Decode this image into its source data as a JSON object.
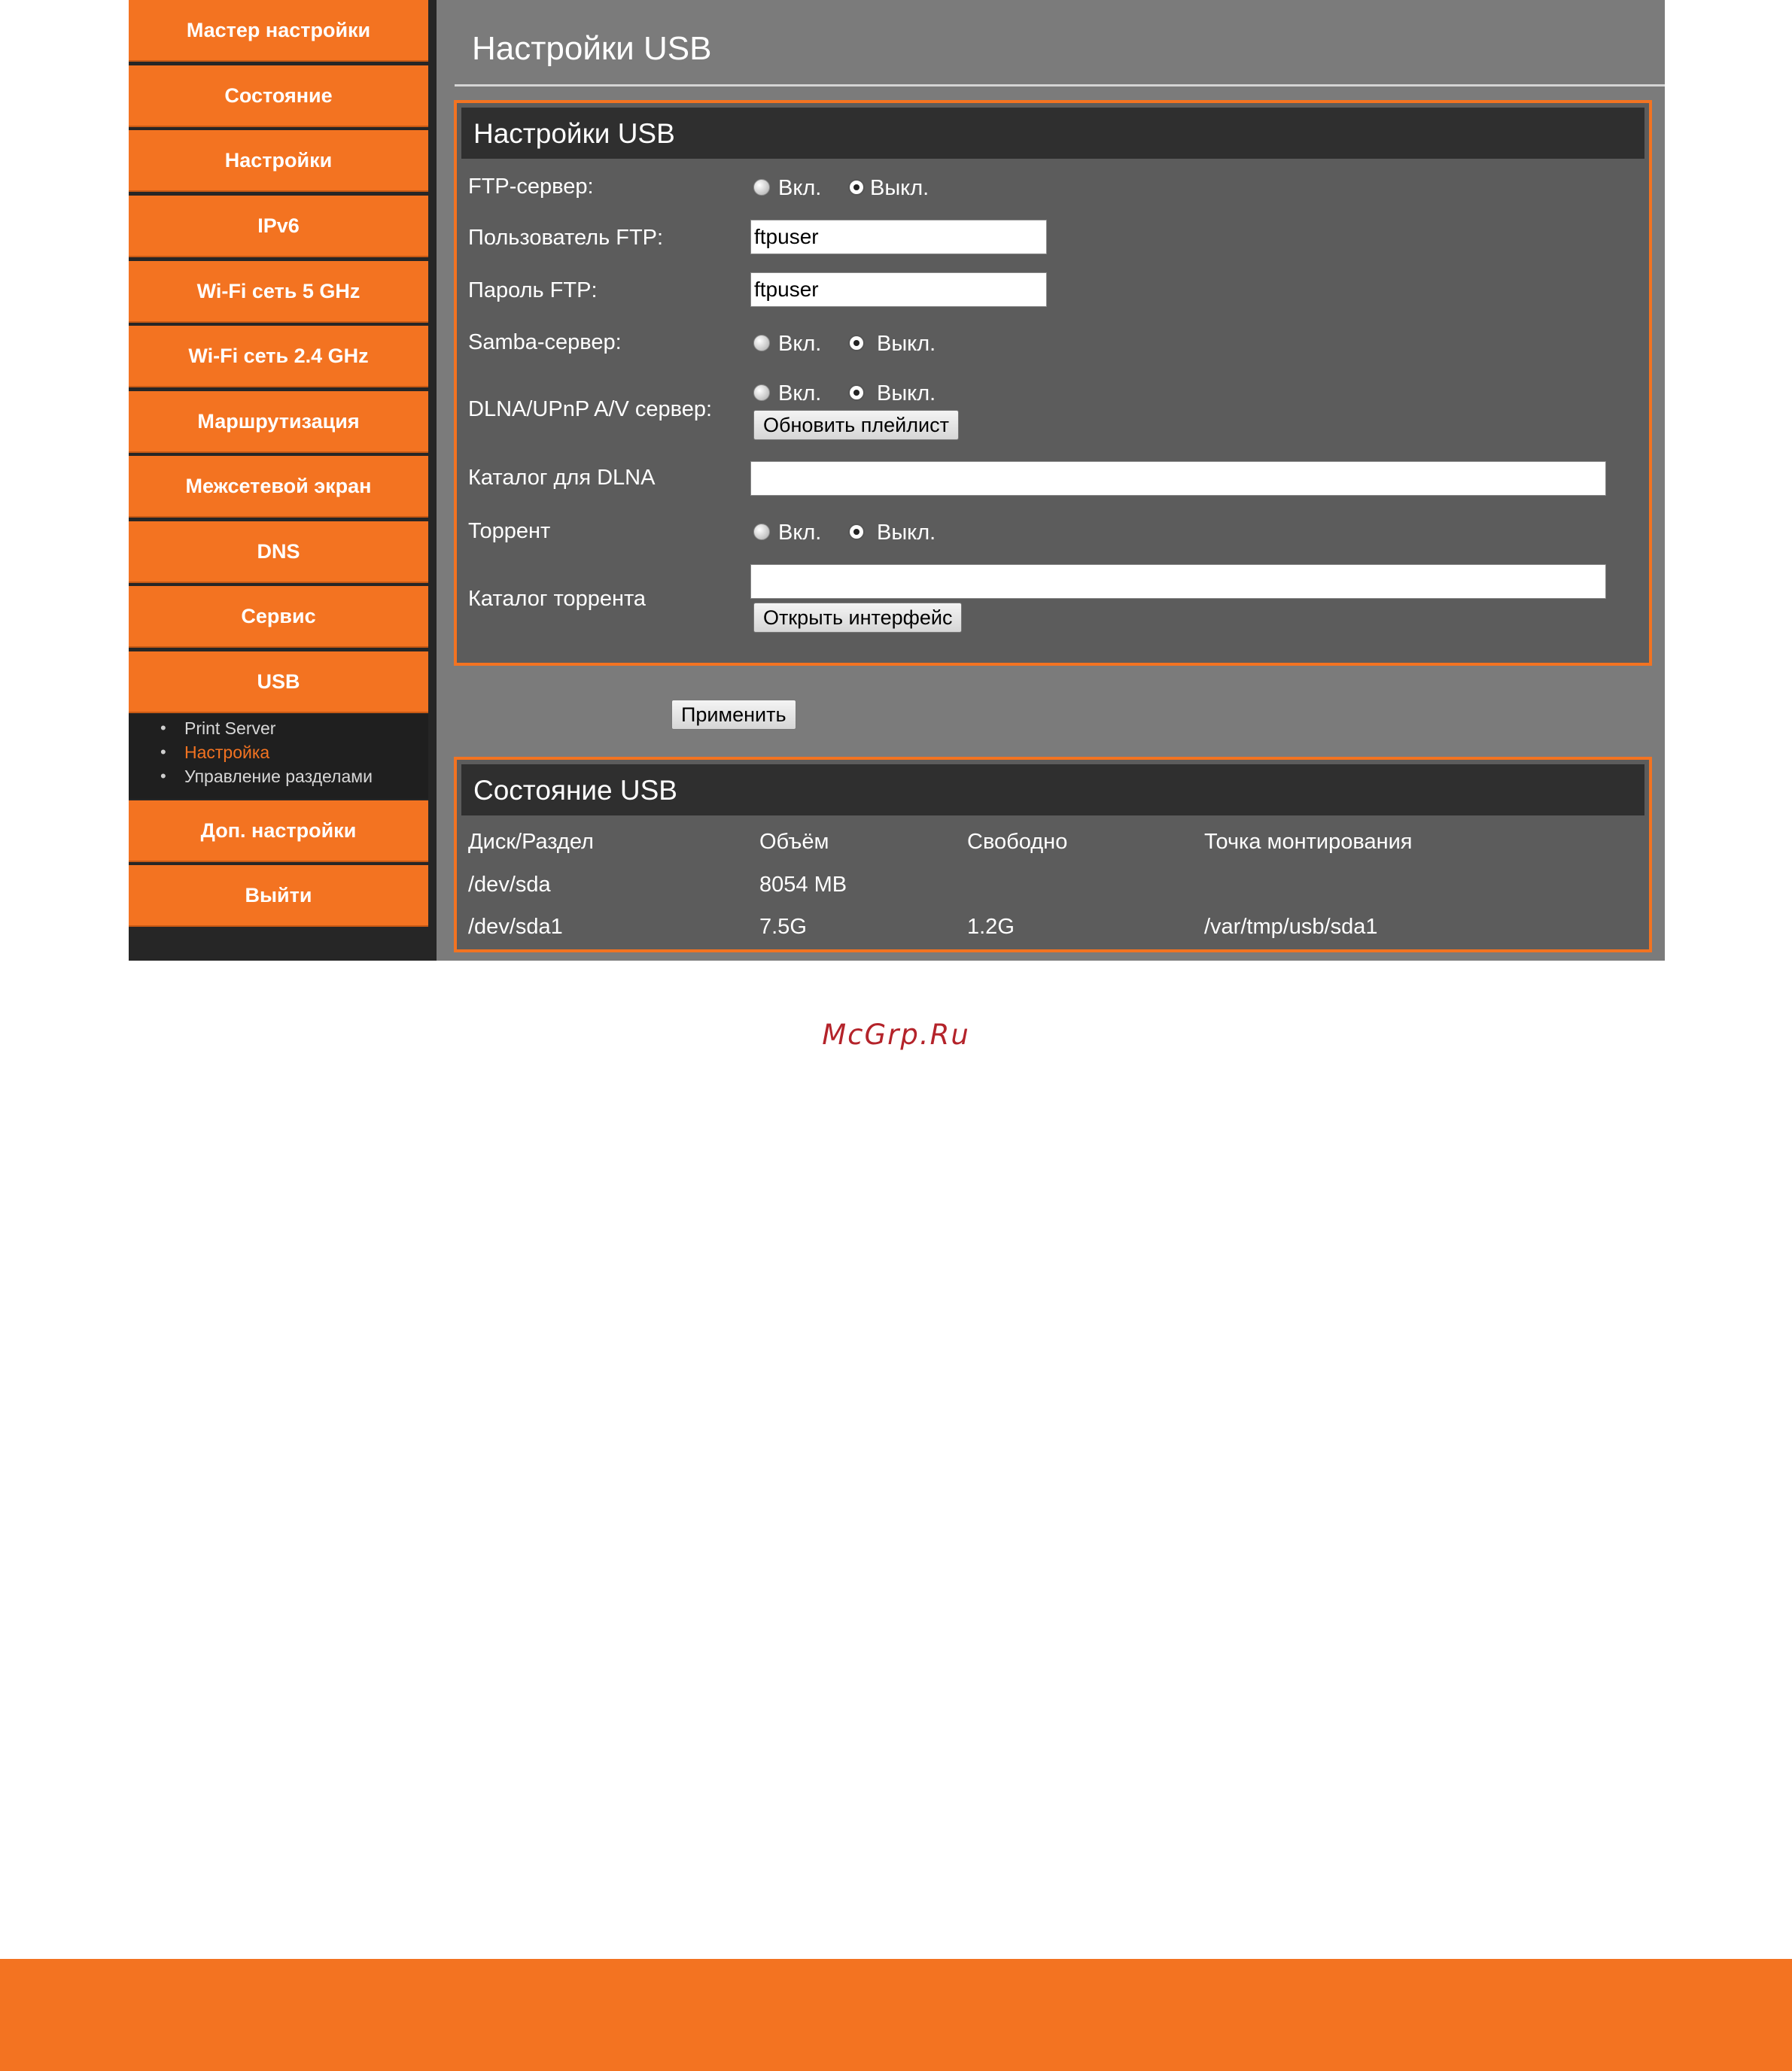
{
  "sidebar": {
    "items": [
      {
        "label": "Мастер настройки"
      },
      {
        "label": "Состояние"
      },
      {
        "label": "Настройки"
      },
      {
        "label": "IPv6"
      },
      {
        "label": "Wi-Fi сеть 5 GHz"
      },
      {
        "label": "Wi-Fi сеть 2.4 GHz"
      },
      {
        "label": "Маршрутизация"
      },
      {
        "label": "Межсетевой экран"
      },
      {
        "label": "DNS"
      },
      {
        "label": "Сервис"
      },
      {
        "label": "USB"
      },
      {
        "label": "Доп. настройки"
      },
      {
        "label": "Выйти"
      }
    ],
    "submenu": [
      {
        "label": "Print Server",
        "active": false
      },
      {
        "label": "Настройка",
        "active": true
      },
      {
        "label": "Управление разделами",
        "active": false
      }
    ]
  },
  "main": {
    "page_title": "Настройки USB",
    "settings": {
      "header": "Настройки USB",
      "ftp_server": {
        "label": "FTP-сервер:",
        "on": "Вкл.",
        "off": "Выкл.",
        "selected": "off"
      },
      "ftp_user": {
        "label": "Пользователь FTP:",
        "value": "ftpuser"
      },
      "ftp_password": {
        "label": "Пароль FTP:",
        "value": "ftpuser"
      },
      "samba_server": {
        "label": "Samba-сервер:",
        "on": "Вкл.",
        "off": "Выкл.",
        "selected": "off"
      },
      "dlna_server": {
        "label": "DLNA/UPnP A/V сервер:",
        "on": "Вкл.",
        "off": "Выкл.",
        "selected": "off",
        "refresh_button": "Обновить плейлист"
      },
      "dlna_dir": {
        "label": "Каталог для DLNA",
        "value": ""
      },
      "torrent": {
        "label": "Торрент",
        "on": "Вкл.",
        "off": "Выкл.",
        "selected": "off"
      },
      "torrent_dir": {
        "label": "Каталог торрента",
        "value": "",
        "open_button": "Открыть интерфейс"
      }
    },
    "apply_button": "Применить",
    "status": {
      "header": "Состояние USB",
      "columns": [
        "Диск/Раздел",
        "Объём",
        "Свободно",
        "Точка монтирования"
      ],
      "rows": [
        [
          "/dev/sda",
          "8054 MB",
          "",
          ""
        ],
        [
          "/dev/sda1",
          "7.5G",
          "1.2G",
          "/var/tmp/usb/sda1"
        ]
      ]
    }
  },
  "watermark": "McGrp.Ru",
  "colors": {
    "accent": "#f37321",
    "panel_bg": "#5c5c5c",
    "main_bg": "#7b7b7b",
    "sidebar_bg": "#262626",
    "watermark": "#b4232a"
  }
}
